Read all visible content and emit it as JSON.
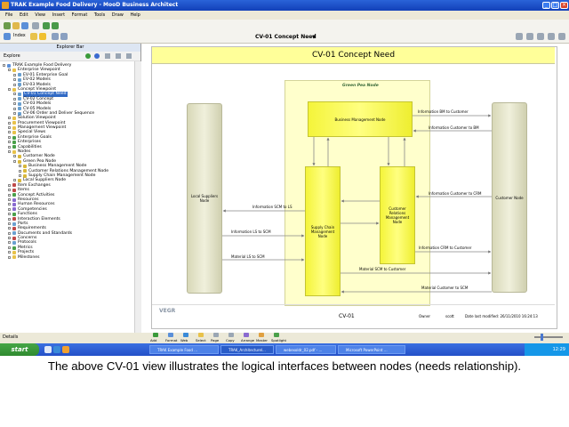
{
  "window": {
    "title": "TRAK Example Food Delivery - MooD Business Architect"
  },
  "menu": [
    "File",
    "Edit",
    "View",
    "Insert",
    "Format",
    "Tools",
    "Draw",
    "Help"
  ],
  "toolbar": {
    "index_label": "Index",
    "doc_title": "CV-01 Concept Need"
  },
  "explorer": {
    "header": "Explorer Bar",
    "explore_label": "Explore",
    "tree": [
      {
        "label": "TRAK Example Food Delivery",
        "level": 0,
        "icon": "#5b8fd8"
      },
      {
        "label": "Enterprise Viewpoint",
        "level": 1,
        "icon": "#e8c24a"
      },
      {
        "label": "EV-01 Enterprise Goal",
        "level": 2,
        "icon": "#6aa0d0"
      },
      {
        "label": "EV-02 Models",
        "level": 2,
        "icon": "#6aa0d0"
      },
      {
        "label": "EV-03 Models",
        "level": 2,
        "icon": "#6aa0d0"
      },
      {
        "label": "Concept Viewpoint",
        "level": 1,
        "icon": "#e8c24a"
      },
      {
        "label": "CV-01 Concept Need",
        "level": 2,
        "icon": "#6aa0d0",
        "selected": true
      },
      {
        "label": "CV-02 Concept",
        "level": 2,
        "icon": "#6aa0d0"
      },
      {
        "label": "CV-03 Models",
        "level": 2,
        "icon": "#6aa0d0"
      },
      {
        "label": "CV-05 Models",
        "level": 2,
        "icon": "#6aa0d0"
      },
      {
        "label": "CV-06 Order and Deliver Sequence",
        "level": 2,
        "icon": "#6aa0d0"
      },
      {
        "label": "Solution Viewpoint",
        "level": 1,
        "icon": "#e8c24a"
      },
      {
        "label": "Procurement Viewpoint",
        "level": 1,
        "icon": "#e8c24a"
      },
      {
        "label": "Management Viewpoint",
        "level": 1,
        "icon": "#e8c24a"
      },
      {
        "label": "Special Views",
        "level": 1,
        "icon": "#e8c24a"
      },
      {
        "label": "Enterprise Goals",
        "level": 1,
        "icon": "#4aa04a"
      },
      {
        "label": "Enterprises",
        "level": 1,
        "icon": "#4aa04a"
      },
      {
        "label": "Capabilities",
        "level": 1,
        "icon": "#4aa04a"
      },
      {
        "label": "Nodes",
        "level": 1,
        "icon": "#e8c24a"
      },
      {
        "label": "Customer Node",
        "level": 2,
        "icon": "#d9b83a"
      },
      {
        "label": "Green Pea Node",
        "level": 2,
        "icon": "#d9b83a"
      },
      {
        "label": "Business Management Node",
        "level": 3,
        "icon": "#d9b83a"
      },
      {
        "label": "Customer Relations Management Node",
        "level": 3,
        "icon": "#d9b83a"
      },
      {
        "label": "Supply Chain Management Node",
        "level": 3,
        "icon": "#d9b83a"
      },
      {
        "label": "Local Suppliers Node",
        "level": 2,
        "icon": "#d9b83a"
      },
      {
        "label": "Item Exchanges",
        "level": 1,
        "icon": "#c04a4a"
      },
      {
        "label": "Items",
        "level": 1,
        "icon": "#c04a4a"
      },
      {
        "label": "Concept Activities",
        "level": 1,
        "icon": "#4aa04a"
      },
      {
        "label": "Resources",
        "level": 1,
        "icon": "#8a6ad0"
      },
      {
        "label": "Human Resources",
        "level": 1,
        "icon": "#8a6ad0"
      },
      {
        "label": "Competencies",
        "level": 1,
        "icon": "#8a6ad0"
      },
      {
        "label": "Functions",
        "level": 1,
        "icon": "#4aa04a"
      },
      {
        "label": "Interaction Elements",
        "level": 1,
        "icon": "#c04a4a"
      },
      {
        "label": "Ports",
        "level": 1,
        "icon": "#6aa0d0"
      },
      {
        "label": "Requirements",
        "level": 1,
        "icon": "#c04a4a"
      },
      {
        "label": "Documents and Standards",
        "level": 1,
        "icon": "#6aa0d0"
      },
      {
        "label": "Concerns",
        "level": 1,
        "icon": "#c04a4a"
      },
      {
        "label": "Protocols",
        "level": 1,
        "icon": "#6aa0d0"
      },
      {
        "label": "Metrics",
        "level": 1,
        "icon": "#4aa04a"
      },
      {
        "label": "Projects",
        "level": 1,
        "icon": "#e8c24a"
      },
      {
        "label": "Milestones",
        "level": 1,
        "icon": "#e8c24a"
      }
    ]
  },
  "diagram": {
    "title": "CV-01 Concept Need",
    "pool_label": "Green Pea Node",
    "nodes": {
      "business": "Business Management Node",
      "local": "Local Suppliers Node",
      "customer": "Customer Node",
      "scm": "Supply Chain Management Node",
      "crm": "Customer Relations Management Node"
    },
    "links": {
      "bm_to_customer": "Information BM to Customer",
      "customer_to_bm": "Information Customer to BM",
      "customer_to_crm": "Information Customer to CRM",
      "scm_to_ls": "Information SCM to LS",
      "ls_to_scm": "Information LS to SCM",
      "crm_to_customer": "Information CRM to Customer",
      "mat_ls_to_scm": "Material LS to SCM",
      "mat_scm_to_customer": "Material SCM to Customer",
      "mat_customer_to_scm": "Material Customer to SCM"
    },
    "footer_name": "CV-01",
    "footer_owner_label": "Owner",
    "footer_owner": "scott",
    "footer_modified": "Date last modified: 26/11/2010 16:24:13",
    "logo": "VEGR"
  },
  "bottom_toolbar": [
    "Add",
    "Format",
    "Web",
    "Select",
    "Page",
    "Copy",
    "Arrange",
    "Master",
    "Spotlight"
  ],
  "status": {
    "details": "Details"
  },
  "taskbar": {
    "start": "start",
    "tasks": [
      "TRAK Example Food ...",
      "TRAK_Architecturel...",
      "webexoldr_02.pdf - ...",
      "Microsoft PowerPoint ..."
    ],
    "clock": "12:29"
  },
  "caption": "The above CV-01 view illustrates the logical interfaces between nodes (needs relationship)."
}
